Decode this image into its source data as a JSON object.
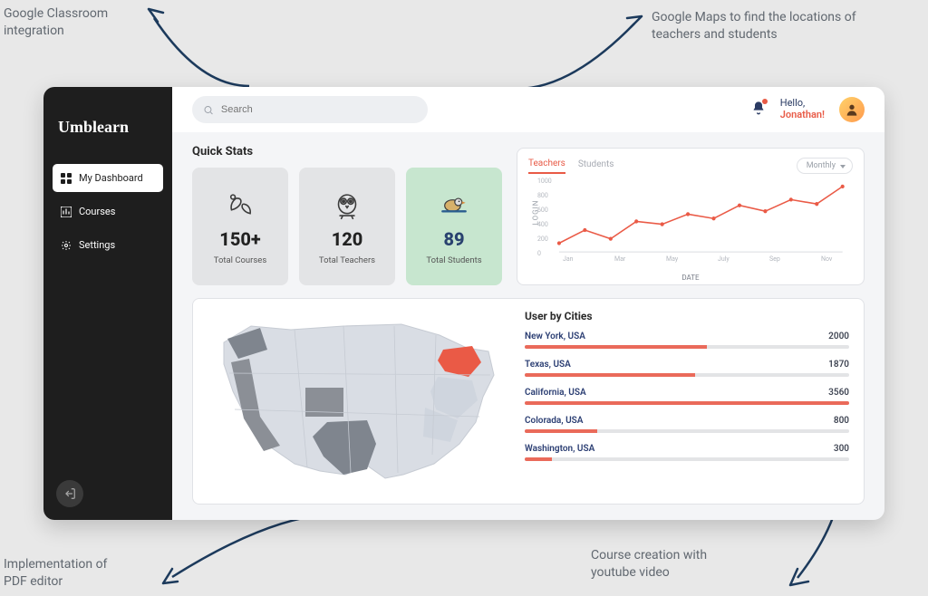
{
  "annotations": {
    "top_left": "Google Classroom\nintegration",
    "top_right": "Google Maps to find the locations of\nteachers and students",
    "bottom_left": "Implementation of\nPDF editor",
    "bottom_right": "Course creation with\nyoutube video"
  },
  "brand": "Umblearn",
  "sidebar": {
    "items": [
      {
        "label": "My Dashboard",
        "active": true
      },
      {
        "label": "Courses",
        "active": false
      },
      {
        "label": "Settings",
        "active": false
      }
    ]
  },
  "search": {
    "placeholder": "Search"
  },
  "user": {
    "greeting": "Hello,",
    "name": "Jonathan!"
  },
  "quick_stats": {
    "title": "Quick Stats",
    "cards": [
      {
        "value": "150+",
        "label": "Total Courses"
      },
      {
        "value": "120",
        "label": "Total Teachers"
      },
      {
        "value": "89",
        "label": "Total Students"
      }
    ]
  },
  "chart": {
    "tabs": [
      "Teachers",
      "Students"
    ],
    "active_tab": "Teachers",
    "dropdown": "Monthly",
    "ylabel": "LOGIN",
    "xlabel": "DATE",
    "yticks": [
      "1000",
      "800",
      "600",
      "400",
      "200",
      "0"
    ],
    "xticks": [
      "Jan",
      "Mar",
      "May",
      "July",
      "Sep",
      "Nov"
    ]
  },
  "user_by_cities": {
    "title": "User by Cities",
    "max": 3560,
    "rows": [
      {
        "name": "New York, USA",
        "value": 2000
      },
      {
        "name": "Texas, USA",
        "value": 1870
      },
      {
        "name": "California, USA",
        "value": 3560
      },
      {
        "name": "Colorada, USA",
        "value": 800
      },
      {
        "name": "Washington, USA",
        "value": 300
      }
    ]
  },
  "chart_data": {
    "type": "line",
    "title": "",
    "xlabel": "DATE",
    "ylabel": "LOGIN",
    "ylim": [
      0,
      1000
    ],
    "x": [
      "Jan",
      "Feb",
      "Mar",
      "Apr",
      "May",
      "Jun",
      "Jul",
      "Aug",
      "Sep",
      "Oct",
      "Nov",
      "Dec"
    ],
    "series": [
      {
        "name": "Teachers",
        "values": [
          120,
          300,
          180,
          420,
          380,
          520,
          460,
          640,
          560,
          720,
          660,
          900
        ]
      }
    ]
  }
}
